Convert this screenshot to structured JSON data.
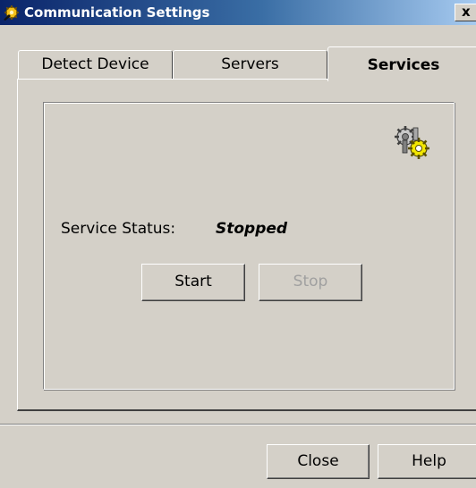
{
  "window": {
    "title": "Communication Settings",
    "close_glyph": "x",
    "title_icon": "app-gear-hand-icon"
  },
  "tabs": [
    {
      "label": "Detect Device",
      "selected": false
    },
    {
      "label": "Servers",
      "selected": false
    },
    {
      "label": "Services",
      "selected": true
    }
  ],
  "services": {
    "icon": "gears-icon",
    "status_label": "Service Status:",
    "status_value": "Stopped",
    "start_label": "Start",
    "stop_label": "Stop",
    "stop_disabled": true
  },
  "footer": {
    "close_label": "Close",
    "help_label": "Help"
  },
  "colors": {
    "face": "#d4d0c8",
    "title_start": "#0a246a",
    "title_end": "#a6caf0",
    "disabled_text": "#a0a0a0"
  }
}
